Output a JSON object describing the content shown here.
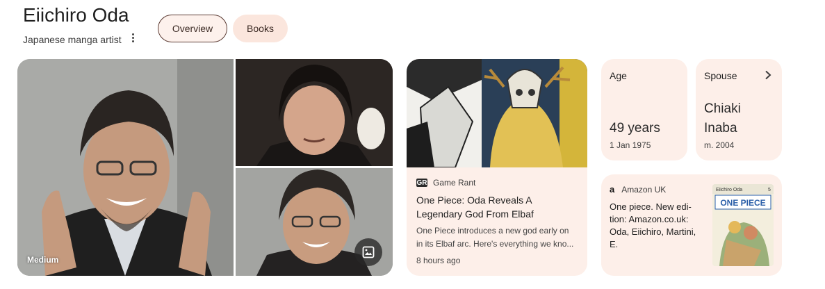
{
  "header": {
    "title": "Eiichiro Oda",
    "subtitle": "Japanese manga artist"
  },
  "tabs": [
    {
      "label": "Overview",
      "selected": true
    },
    {
      "label": "Books",
      "selected": false
    }
  ],
  "images": {
    "source_label": "Medium"
  },
  "news": {
    "source": "Game Rant",
    "source_logo": "GR",
    "headline": "One Piece: Oda Reveals A Legendary God From Elbaf",
    "snippet": "One Piece introduces a new god early on in its Elbaf arc. Here's everything we kno...",
    "time": "8 hours ago"
  },
  "facts": {
    "age": {
      "label": "Age",
      "value": "49 years",
      "sub": "1 Jan 1975"
    },
    "spouse": {
      "label": "Spouse",
      "value_line1": "Chiaki",
      "value_line2": "Inaba",
      "sub": "m. 2004"
    }
  },
  "amazon": {
    "source": "Amazon UK",
    "logo": "a",
    "text": "One piece. New edi- tion: Amazon.co.uk: Oda, Eiichiro, Martini, E.",
    "cover_author": "Eiichiro Oda",
    "cover_title": "ONE PIECE",
    "cover_volume": "5"
  },
  "colors": {
    "card_bg": "#fdefe9",
    "pill_selected_border": "#5a3a32",
    "pill_bg": "#fbe6dd"
  }
}
